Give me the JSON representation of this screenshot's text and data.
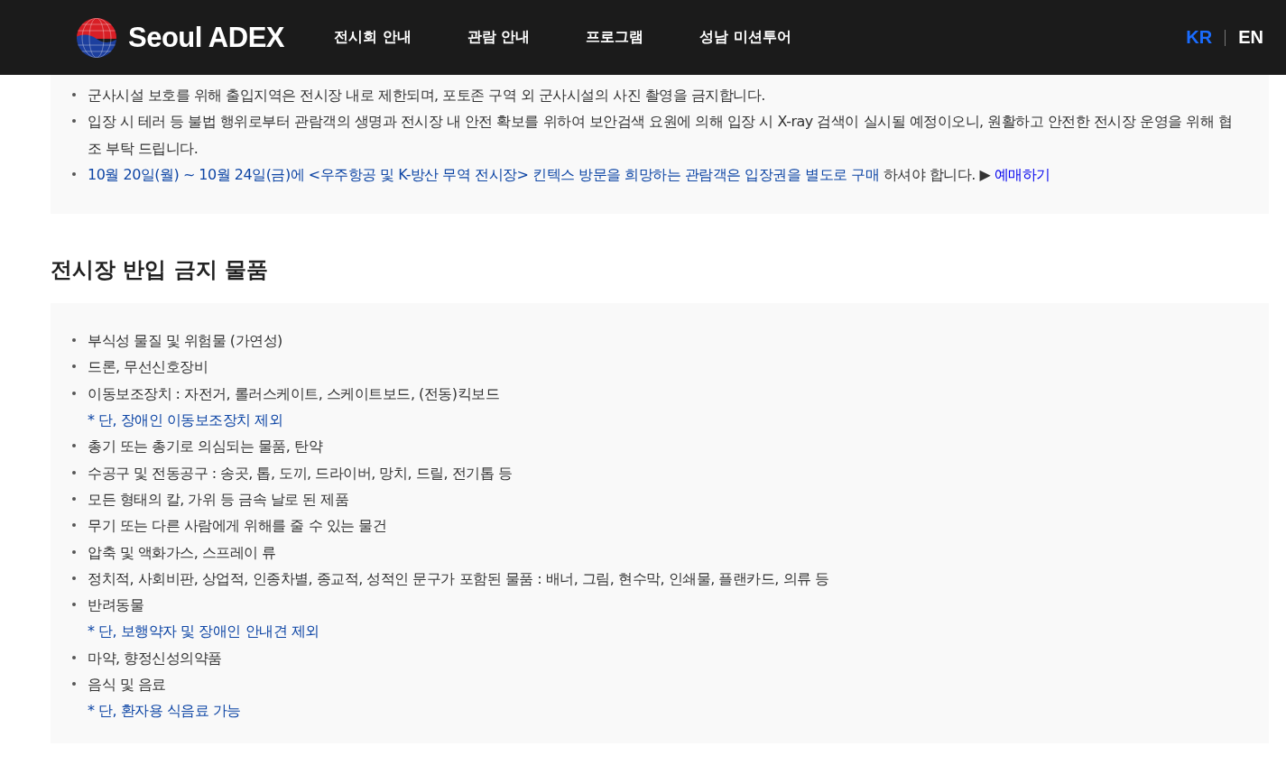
{
  "header": {
    "brand": "Seoul ADEX",
    "nav": [
      "전시회 안내",
      "관람 안내",
      "프로그램",
      "성남 미션투어"
    ],
    "languages": [
      {
        "label": "KR",
        "selected": true
      },
      {
        "label": "EN",
        "selected": false
      }
    ]
  },
  "notice_items": [
    {
      "kind": "bullet",
      "segments": [
        {
          "kind": "plain",
          "text": "군사시설 보호를 위해 출입지역은 전시장 내로 제한되며, 포토존 구역 외 군사시설의 사진 촬영을 금지합니다."
        }
      ]
    },
    {
      "kind": "bullet",
      "segments": [
        {
          "kind": "plain",
          "text": "입장 시 테러 등 불법 행위로부터 관람객의 생명과 전시장 내 안전 확보를 위하여 보안검색 요원에 의해 입장 시 X-ray 검색이 실시될 예정이오니, 원활하고 안전한 전시장 운영을 위해 협조 부탁 드립니다."
        }
      ]
    },
    {
      "kind": "bullet",
      "segments": [
        {
          "kind": "highlight",
          "text": "10월 20일(월) ~ 10월 24일(금)에 <우주항공 및 K-방산 무역 전시장> 킨텍스 방문을 희망하는 관람객은 입장권을 별도로 구매"
        },
        {
          "kind": "plain",
          "text": " 하셔야 합니다. ▶ "
        },
        {
          "kind": "link",
          "text": "예매하기"
        }
      ]
    }
  ],
  "banned_section": {
    "title": "전시장 반입 금지 물품",
    "items": [
      {
        "kind": "bullet",
        "text": "부식성 물질 및 위험물 (가연성)"
      },
      {
        "kind": "bullet",
        "text": "드론, 무선신호장비"
      },
      {
        "kind": "bullet",
        "text": "이동보조장치 : 자전거, 롤러스케이트, 스케이트보드, (전동)킥보드"
      },
      {
        "kind": "note",
        "text": "* 단, 장애인 이동보조장치 제외"
      },
      {
        "kind": "bullet",
        "text": "총기 또는 총기로 의심되는 물품, 탄약"
      },
      {
        "kind": "bullet",
        "text": "수공구 및 전동공구 : 송곳, 톱, 도끼, 드라이버, 망치, 드릴, 전기톱 등"
      },
      {
        "kind": "bullet",
        "text": "모든 형태의 칼, 가위 등 금속 날로 된 제품"
      },
      {
        "kind": "bullet",
        "text": "무기 또는 다른 사람에게 위해를 줄 수 있는 물건"
      },
      {
        "kind": "bullet",
        "text": "압축 및 액화가스, 스프레이 류"
      },
      {
        "kind": "bullet",
        "text": "정치적, 사회비판, 상업적, 인종차별, 종교적, 성적인 문구가 포함된 물품 : 배너, 그림, 현수막, 인쇄물, 플랜카드, 의류 등"
      },
      {
        "kind": "bullet",
        "text": "반려동물"
      },
      {
        "kind": "note",
        "text": "* 단, 보행약자 및 장애인 안내견 제외"
      },
      {
        "kind": "bullet",
        "text": "마약, 향정신성의약품"
      },
      {
        "kind": "bullet",
        "text": "음식 및 음료"
      },
      {
        "kind": "note",
        "text": "* 단, 환자용 식음료 가능"
      }
    ]
  }
}
